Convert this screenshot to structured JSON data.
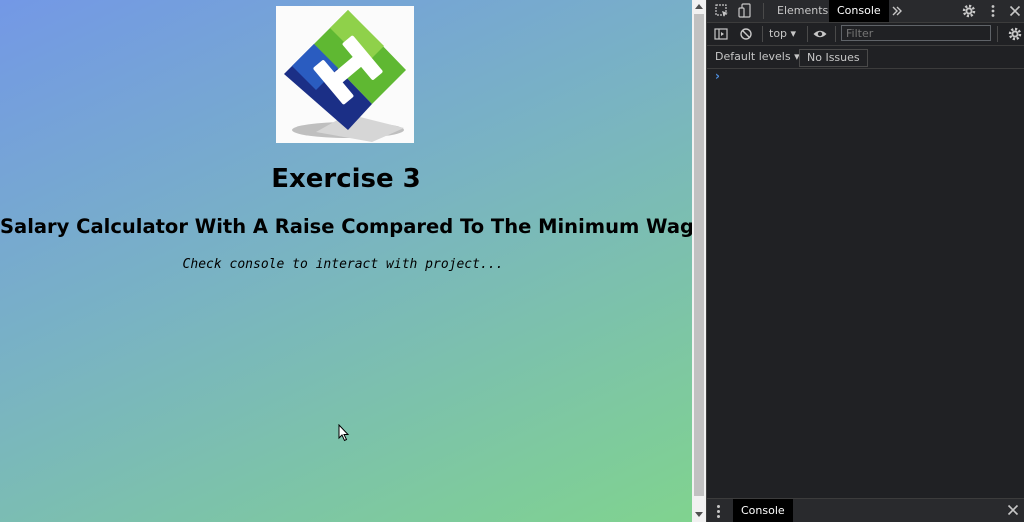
{
  "page": {
    "heading": "Exercise 3",
    "subheading": "Salary Calculator With A Raise Compared To The Minimum Wage",
    "hint": "Check console to interact with project..."
  },
  "devtools": {
    "tabs": [
      {
        "label": "Elements",
        "active": false
      },
      {
        "label": "Console",
        "active": true
      }
    ],
    "context": "top",
    "filter_placeholder": "Filter",
    "levels": "Default levels",
    "issues": "No Issues",
    "prompt": "›",
    "drawer_tab": "Console"
  },
  "colors": {
    "gradient_start": "#7398e6",
    "gradient_end": "#80d38f",
    "devtools_bg": "#202124",
    "logo_green": "#5fb832",
    "logo_blue": "#1b2f86"
  },
  "icons": [
    "inspect-element-icon",
    "device-toolbar-icon",
    "more-tabs-icon",
    "settings-icon",
    "kebab-menu-icon",
    "close-icon",
    "sidebar-toggle-icon",
    "clear-console-icon",
    "eye-icon",
    "console-settings-icon",
    "drawer-close-icon",
    "mouse-cursor-icon"
  ]
}
